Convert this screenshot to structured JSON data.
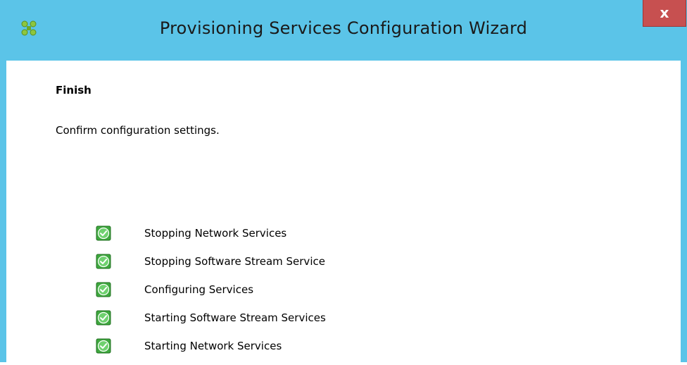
{
  "window": {
    "title": "Provisioning Services Configuration Wizard",
    "close_label": "x",
    "accent_color": "#5bc4e8",
    "close_color": "#c75050"
  },
  "page": {
    "heading": "Finish",
    "subtitle": "Confirm configuration settings."
  },
  "steps": [
    {
      "label": "Stopping Network Services",
      "status": "completed",
      "icon": "green-check-icon"
    },
    {
      "label": "Stopping Software Stream Service",
      "status": "completed",
      "icon": "green-check-icon"
    },
    {
      "label": "Configuring Services",
      "status": "completed",
      "icon": "green-check-icon"
    },
    {
      "label": "Starting Software Stream Services",
      "status": "completed",
      "icon": "green-check-icon"
    },
    {
      "label": "Starting Network Services",
      "status": "completed",
      "icon": "green-check-icon"
    }
  ]
}
